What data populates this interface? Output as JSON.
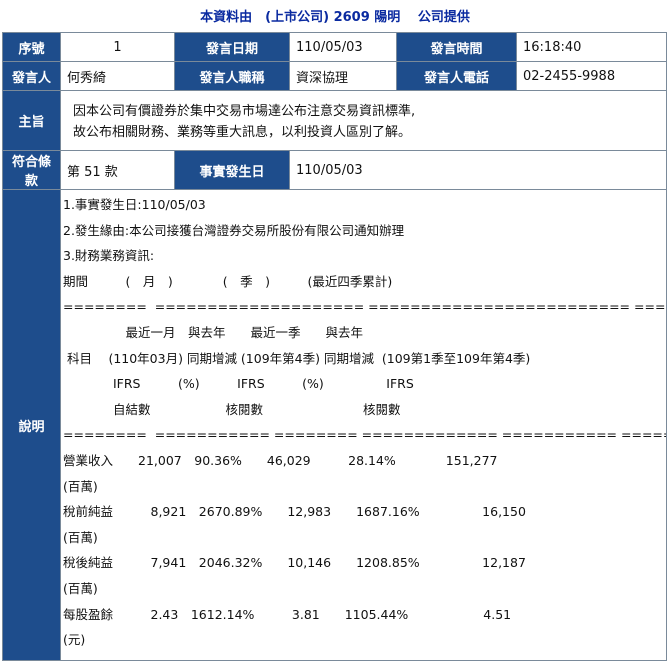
{
  "header": {
    "text": "本資料由　(上市公司) 2609 陽明　 公司提供"
  },
  "labels": {
    "seq": "序號",
    "date": "發言日期",
    "time": "發言時間",
    "speaker": "發言人",
    "title": "發言人職稱",
    "phone": "發言人電話",
    "subject": "主旨",
    "clause": "符合條款",
    "event_date": "事實發生日",
    "description": "說明"
  },
  "values": {
    "seq": "1",
    "date": "110/05/03",
    "time": "16:18:40",
    "speaker": "何秀綺",
    "title": "資深協理",
    "phone": "02-2455-9988",
    "subject_line1": "因本公司有價證券於集中交易市場達公布注意交易資訊標準,",
    "subject_line2": "故公布相關財務、業務等重大訊息，以利投資人區別了解。",
    "clause": "第 51 款",
    "event_date": "110/05/03"
  },
  "description_lines": [
    "1.事實發生日:110/05/03",
    "2.發生緣由:本公司接獲台灣證券交易所股份有限公司通知辦理",
    "3.財務業務資訊:",
    "期間　　　(　月　)　　　　(　季　)　　　(最近四季累計)",
    "========  ==================== ========================= ====================",
    "　　　　　最近一月　與去年　　最近一季　　與去年",
    " 科目　 (110年03月) 同期增減 (109年第4季) 同期增減  (109第1季至109年第4季)",
    "　　　　IFRS　　　(%)　　　IFRS　　　(%)　　　　　IFRS",
    "　　　　自結數　　　　　　核閱數　　　　　　　　核閱數",
    "========  =========== ======== ============= =========== ====================",
    "營業收入　　21,007　90.36%　　46,029　　　28.14%　　　　151,277",
    "(百萬)",
    "稅前純益　　　8,921　2670.89%　　12,983　　1687.16%　　　　　16,150",
    "(百萬)",
    "稅後純益　　　7,941　2046.32%　　10,146　　1208.85%　　　　　12,187",
    "(百萬)",
    "每股盈餘　　　2.43　1612.14%　　　3.81　　1105.44%　　　　　　4.51",
    "(元)"
  ]
}
